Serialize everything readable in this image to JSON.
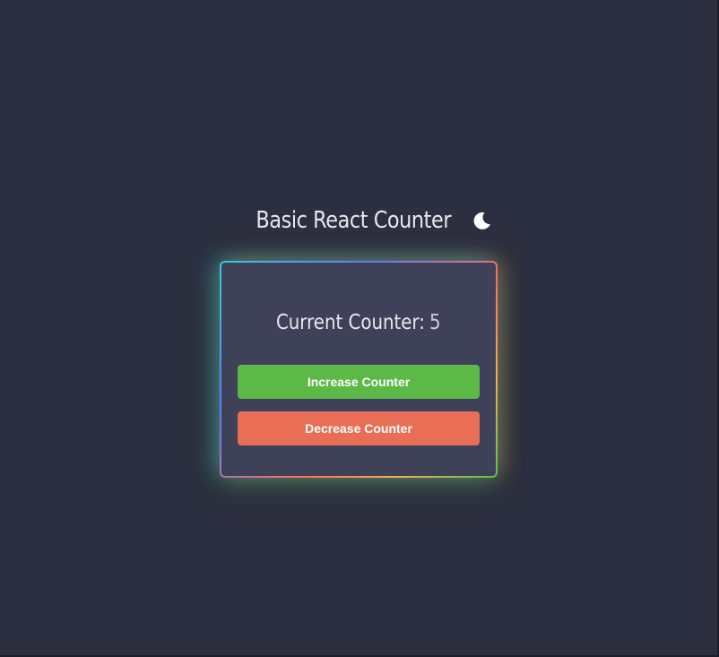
{
  "header": {
    "title": "Basic React Counter",
    "theme_icon": "moon-icon"
  },
  "counter": {
    "label": "Current Counter:",
    "value": "5"
  },
  "buttons": {
    "increase_label": "Increase Counter",
    "decrease_label": "Decrease Counter"
  },
  "colors": {
    "background": "#2c2f3f",
    "card": "#3e4158",
    "increase": "#5cb947",
    "decrease": "#e86e56",
    "text": "#e7e8ee"
  }
}
